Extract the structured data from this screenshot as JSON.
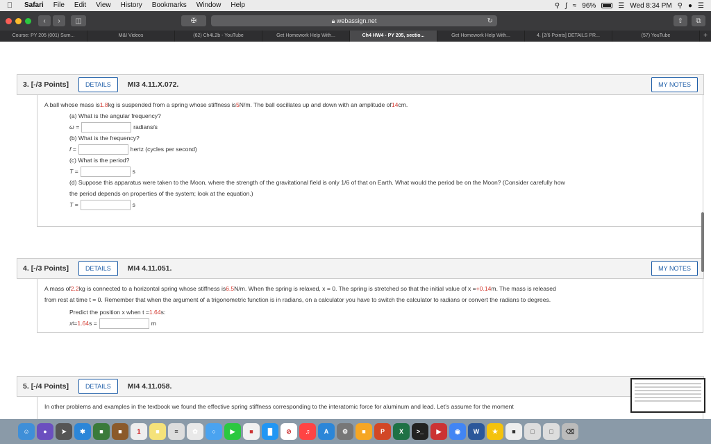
{
  "menubar": {
    "app": "Safari",
    "items": [
      "File",
      "Edit",
      "View",
      "History",
      "Bookmarks",
      "Window",
      "Help"
    ],
    "battery": "96%",
    "battery_level": 0.96,
    "clock": "Wed 8:34 PM"
  },
  "toolbar": {
    "url": "webassign.net"
  },
  "tabs": [
    {
      "label": "Course: PY 205 (001) Sum...",
      "active": false
    },
    {
      "label": "M&I Videos",
      "active": false
    },
    {
      "label": "(62) Ch4L2b - YouTube",
      "active": false
    },
    {
      "label": "Get Homework Help With...",
      "active": false
    },
    {
      "label": "Ch4 HW4 - PY 205, sectio...",
      "active": true
    },
    {
      "label": "Get Homework Help With...",
      "active": false
    },
    {
      "label": "4. [2/6 Points] DETAILS PR...",
      "active": false
    },
    {
      "label": "(57) YouTube",
      "active": false
    }
  ],
  "colors": {
    "accent": "#1f5ea8",
    "highlight_red": "#d2372d"
  },
  "q3": {
    "num": "3.",
    "points": "[-/3 Points]",
    "details": "DETAILS",
    "id": "MI3 4.11.X.072.",
    "notes": "MY NOTES",
    "intro_1": "A ball whose mass is ",
    "mass": "1.8",
    "intro_2": " kg is suspended from a spring whose stiffness is ",
    "k": "5",
    "intro_3": " N/m. The ball oscillates up and down with an amplitude of ",
    "amp": "14",
    "intro_4": " cm.",
    "a_q": "(a) What is the angular frequency?",
    "a_lbl": "ω =",
    "a_unit": "radians/s",
    "b_q": "(b) What is the frequency?",
    "b_lbl": "f =",
    "b_unit": "hertz (cycles per second)",
    "c_q": "(c) What is the period?",
    "c_lbl": "T =",
    "c_unit": "s",
    "d_q1": "(d) Suppose this apparatus were taken to the Moon, where the strength of the gravitational field is only 1/6 of that on Earth. What would the period be on the Moon? (Consider carefully how",
    "d_q2": "the period depends on properties of the system; look at the equation.)",
    "d_lbl": "T =",
    "d_unit": "s"
  },
  "q4": {
    "num": "4.",
    "points": "[-/3 Points]",
    "details": "DETAILS",
    "id": "MI4 4.11.051.",
    "notes": "MY NOTES",
    "t1": "A mass of ",
    "mass": "2.2",
    "t2": " kg is connected to a horizontal spring whose stiffness is ",
    "k": "6.5",
    "t3": " N/m. When the spring is relaxed, x = 0. The spring is stretched so that the initial value of x = ",
    "x0": "+0.14",
    "t4": " m. The mass is released",
    "t5": "from rest at time t = 0. Remember that when the argument of a trigonometric function is in radians, on a calculator you have to switch the calculator to radians or convert the radians to degrees.",
    "predict_1": "Predict the position x when t = ",
    "t_val": "1.64",
    "predict_2": " s:",
    "ans_pre": "x",
    "ans_sub": "t",
    "ans_eq": "=",
    "ans_t": "1.64",
    "ans_s": " s =",
    "ans_unit": "m"
  },
  "q5": {
    "num": "5.",
    "points": "[-/4 Points]",
    "details": "DETAILS",
    "id": "MI4 4.11.058.",
    "text": "In other problems and examples in the textbook we found the effective spring stiffness corresponding to the interatomic force for aluminum and lead. Let's assume for the moment"
  }
}
